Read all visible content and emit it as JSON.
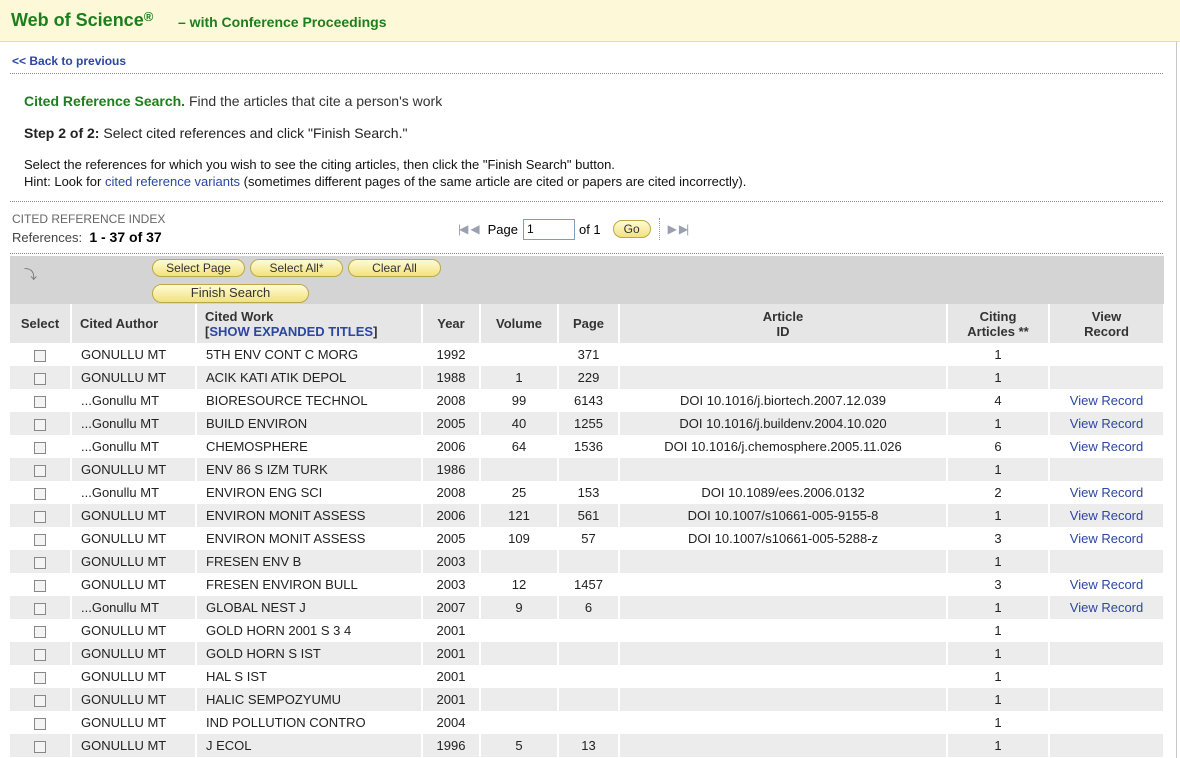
{
  "header": {
    "brand": "Web of Science",
    "reg": "®",
    "subtitle": "– with Conference Proceedings"
  },
  "nav": {
    "back": "<< Back to previous"
  },
  "intro": {
    "title": "Cited Reference Search.",
    "title_rest": " Find the articles that cite a person's work",
    "step": "Step 2 of 2:",
    "step_rest": " Select cited references and click \"Finish Search.\"",
    "line1": "Select the references for which you wish to see the citing articles, then click the \"Finish Search\" button.",
    "hint_prefix": "Hint: Look for ",
    "hint_link": "cited reference variants",
    "hint_suffix": " (sometimes different pages of the same article are cited or papers are cited incorrectly)."
  },
  "index": {
    "title": "CITED REFERENCE INDEX",
    "refs_label": "References:",
    "refs_range": "1 - 37 of  37"
  },
  "pager": {
    "first_icon": "first-page-icon",
    "prev_icon": "prev-page-icon",
    "next_icon": "next-page-icon",
    "last_icon": "last-page-icon",
    "page_label": "Page",
    "page_value": "1",
    "of_label": "of 1",
    "go": "Go"
  },
  "toolbar": {
    "select_page": "Select Page",
    "select_all": "Select All*",
    "clear_all": "Clear All",
    "finish": "Finish Search",
    "arrow_icon": "down-arrow-icon"
  },
  "table": {
    "headers": {
      "select": "Select",
      "author": "Cited Author",
      "work": "Cited Work",
      "expand_bracket_open": "[",
      "expand": "SHOW EXPANDED TITLES",
      "expand_bracket_close": "]",
      "year": "Year",
      "volume": "Volume",
      "page": "Page",
      "article_1": "Article",
      "article_2": "ID",
      "citing_1": "Citing",
      "citing_2": "Articles **",
      "view_1": "View",
      "view_2": "Record"
    },
    "rows": [
      {
        "author": "GONULLU MT",
        "work": "5TH ENV CONT C MORG",
        "year": "1992",
        "volume": "",
        "page": "371",
        "article_id": "",
        "citing": "1",
        "view": ""
      },
      {
        "author": "GONULLU MT",
        "work": "ACIK KATI ATIK DEPOL",
        "year": "1988",
        "volume": "1",
        "page": "229",
        "article_id": "",
        "citing": "1",
        "view": ""
      },
      {
        "author": "...Gonullu MT",
        "work": "BIORESOURCE TECHNOL",
        "year": "2008",
        "volume": "99",
        "page": "6143",
        "article_id": "DOI 10.1016/j.biortech.2007.12.039",
        "citing": "4",
        "view": "View Record"
      },
      {
        "author": "...Gonullu MT",
        "work": "BUILD ENVIRON",
        "year": "2005",
        "volume": "40",
        "page": "1255",
        "article_id": "DOI 10.1016/j.buildenv.2004.10.020",
        "citing": "1",
        "view": "View Record"
      },
      {
        "author": "...Gonullu MT",
        "work": "CHEMOSPHERE",
        "year": "2006",
        "volume": "64",
        "page": "1536",
        "article_id": "DOI 10.1016/j.chemosphere.2005.11.026",
        "citing": "6",
        "view": "View Record"
      },
      {
        "author": "GONULLU MT",
        "work": "ENV 86 S IZM TURK",
        "year": "1986",
        "volume": "",
        "page": "",
        "article_id": "",
        "citing": "1",
        "view": ""
      },
      {
        "author": "...Gonullu MT",
        "work": "ENVIRON ENG SCI",
        "year": "2008",
        "volume": "25",
        "page": "153",
        "article_id": "DOI 10.1089/ees.2006.0132",
        "citing": "2",
        "view": "View Record"
      },
      {
        "author": "GONULLU MT",
        "work": "ENVIRON MONIT ASSESS",
        "year": "2006",
        "volume": "121",
        "page": "561",
        "article_id": "DOI 10.1007/s10661-005-9155-8",
        "citing": "1",
        "view": "View Record"
      },
      {
        "author": "GONULLU MT",
        "work": "ENVIRON MONIT ASSESS",
        "year": "2005",
        "volume": "109",
        "page": "57",
        "article_id": "DOI 10.1007/s10661-005-5288-z",
        "citing": "3",
        "view": "View Record"
      },
      {
        "author": "GONULLU MT",
        "work": "FRESEN ENV B",
        "year": "2003",
        "volume": "",
        "page": "",
        "article_id": "",
        "citing": "1",
        "view": ""
      },
      {
        "author": "GONULLU MT",
        "work": "FRESEN ENVIRON BULL",
        "year": "2003",
        "volume": "12",
        "page": "1457",
        "article_id": "",
        "citing": "3",
        "view": "View Record"
      },
      {
        "author": "...Gonullu MT",
        "work": "GLOBAL NEST J",
        "year": "2007",
        "volume": "9",
        "page": "6",
        "article_id": "",
        "citing": "1",
        "view": "View Record"
      },
      {
        "author": "GONULLU MT",
        "work": "GOLD HORN 2001 S 3 4",
        "year": "2001",
        "volume": "",
        "page": "",
        "article_id": "",
        "citing": "1",
        "view": ""
      },
      {
        "author": "GONULLU MT",
        "work": "GOLD HORN S IST",
        "year": "2001",
        "volume": "",
        "page": "",
        "article_id": "",
        "citing": "1",
        "view": ""
      },
      {
        "author": "GONULLU MT",
        "work": "HAL S IST",
        "year": "2001",
        "volume": "",
        "page": "",
        "article_id": "",
        "citing": "1",
        "view": ""
      },
      {
        "author": "GONULLU MT",
        "work": "HALIC SEMPOZYUMU",
        "year": "2001",
        "volume": "",
        "page": "",
        "article_id": "",
        "citing": "1",
        "view": ""
      },
      {
        "author": "GONULLU MT",
        "work": "IND POLLUTION CONTRO",
        "year": "2004",
        "volume": "",
        "page": "",
        "article_id": "",
        "citing": "1",
        "view": ""
      },
      {
        "author": "GONULLU MT",
        "work": "J ECOL",
        "year": "1996",
        "volume": "5",
        "page": "13",
        "article_id": "",
        "citing": "1",
        "view": ""
      }
    ]
  }
}
